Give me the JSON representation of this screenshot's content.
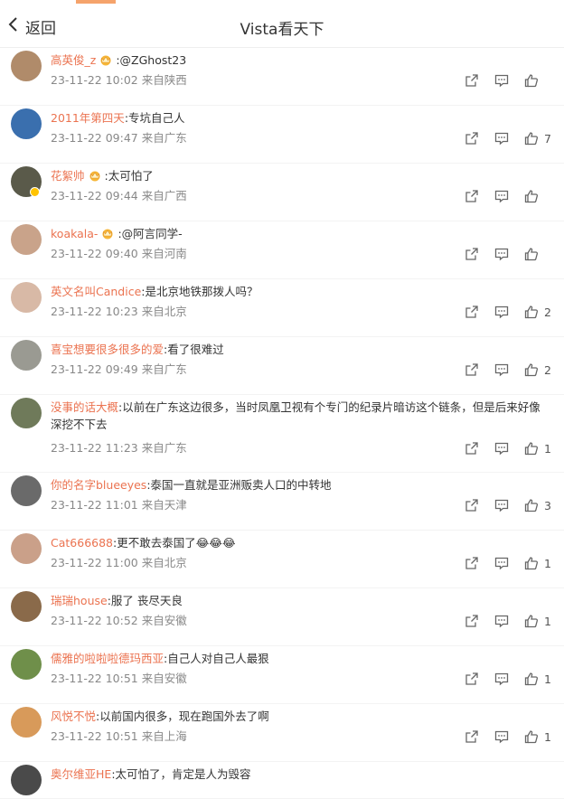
{
  "header": {
    "back_label": "返回",
    "title": "Vista看天下"
  },
  "comments": [
    {
      "user": "高英俊_z",
      "text": ":@ZGhost23",
      "time": "23-11-22 10:02",
      "loc": "来自陕西",
      "likes": "",
      "crown": true,
      "badge": false,
      "avatar_color": "#b08b6a"
    },
    {
      "user": "2011年第四天",
      "text": ":专坑自己人",
      "time": "23-11-22 09:47",
      "loc": "来自广东",
      "likes": "7",
      "crown": false,
      "badge": false,
      "avatar_color": "#3a6fae"
    },
    {
      "user": "花絮帅",
      "text": ":太可怕了",
      "time": "23-11-22 09:44",
      "loc": "来自广西",
      "likes": "",
      "crown": true,
      "badge": true,
      "avatar_color": "#5a5a4a"
    },
    {
      "user": "koakala-",
      "text": ":@阿言同学-",
      "time": "23-11-22 09:40",
      "loc": "来自河南",
      "likes": "",
      "crown": true,
      "badge": false,
      "avatar_color": "#c9a38a"
    },
    {
      "user": "英文名叫Candice",
      "text": ":是北京地铁那拨人吗？",
      "time": "23-11-22 10:23",
      "loc": "来自北京",
      "likes": "2",
      "crown": false,
      "badge": false,
      "avatar_color": "#d8b9a6"
    },
    {
      "user": "喜宝想要很多很多的爱",
      "text": ":看了很难过",
      "time": "23-11-22 09:49",
      "loc": "来自广东",
      "likes": "2",
      "crown": false,
      "badge": false,
      "avatar_color": "#9a9a92"
    },
    {
      "user": "没事的话大概",
      "text": ":以前在广东这边很多，当时凤凰卫视有个专门的纪录片暗访这个链条，但是后来好像深挖不下去",
      "time": "23-11-22 11:23",
      "loc": "来自广东",
      "likes": "1",
      "crown": false,
      "badge": false,
      "avatar_color": "#6f7a5a"
    },
    {
      "user": "你的名字blueeyes",
      "text": ":泰国一直就是亚洲贩卖人口的中转地",
      "time": "23-11-22 11:01",
      "loc": "来自天津",
      "likes": "3",
      "crown": false,
      "badge": false,
      "avatar_color": "#6a6a6a"
    },
    {
      "user": "Cat666688",
      "text": ":更不敢去泰国了😂😂😂",
      "time": "23-11-22 11:00",
      "loc": "来自北京",
      "likes": "1",
      "crown": false,
      "badge": false,
      "avatar_color": "#caa089"
    },
    {
      "user": "瑞瑞house",
      "text": ":服了 丧尽天良",
      "time": "23-11-22 10:52",
      "loc": "来自安徽",
      "likes": "1",
      "crown": false,
      "badge": false,
      "avatar_color": "#8a6a4a"
    },
    {
      "user": "儒雅的啦啦啦德玛西亚",
      "text": ":自己人对自己人最狠",
      "time": "23-11-22 10:51",
      "loc": "来自安徽",
      "likes": "1",
      "crown": false,
      "badge": false,
      "avatar_color": "#6f8f4a"
    },
    {
      "user": "风悦不悦",
      "text": ":以前国内很多，现在跑国外去了啊",
      "time": "23-11-22 10:51",
      "loc": "来自上海",
      "likes": "1",
      "crown": false,
      "badge": false,
      "avatar_color": "#d89a5a"
    },
    {
      "user": "奥尔维亚HE",
      "text": ":太可怕了，肯定是人为毁容",
      "time": "",
      "loc": "",
      "likes": "",
      "crown": false,
      "badge": false,
      "avatar_color": "#4a4a4a"
    }
  ]
}
